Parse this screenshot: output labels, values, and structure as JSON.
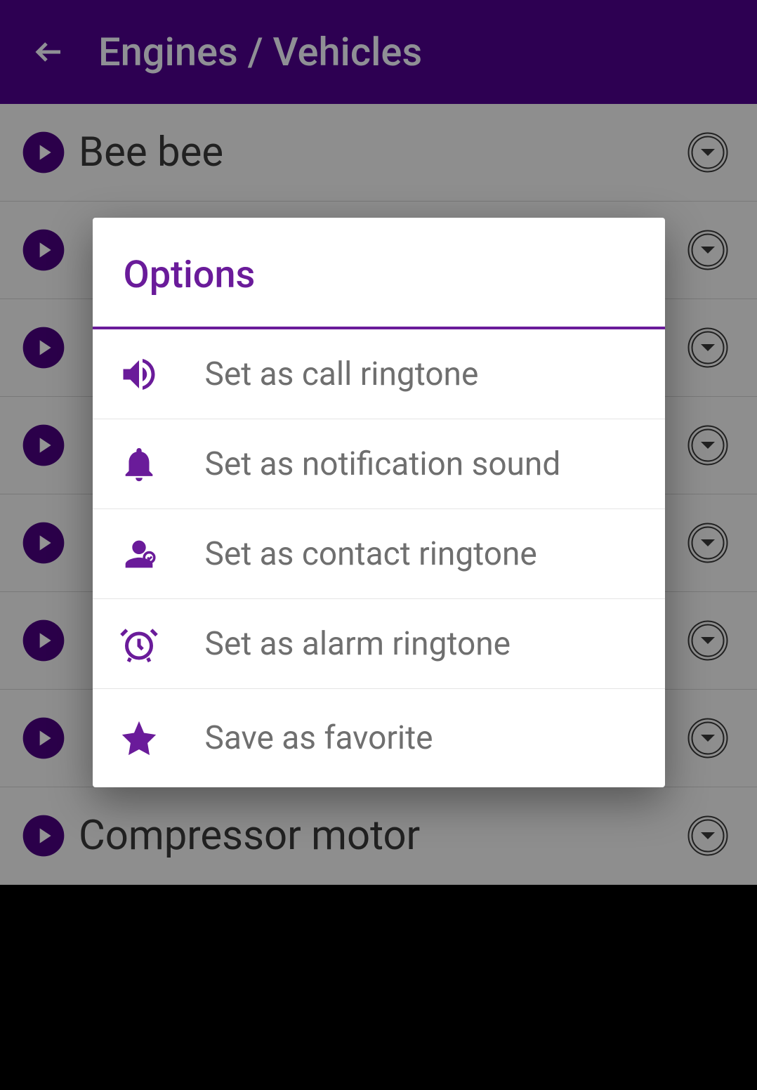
{
  "header": {
    "title": "Engines / Vehicles"
  },
  "list": {
    "items": [
      {
        "label": "Bee bee"
      },
      {
        "label": ""
      },
      {
        "label": ""
      },
      {
        "label": ""
      },
      {
        "label": ""
      },
      {
        "label": ""
      },
      {
        "label": ""
      },
      {
        "label": "Compressor motor"
      }
    ]
  },
  "dialog": {
    "title": "Options",
    "options": [
      {
        "icon": "volume-icon",
        "label": "Set as call ringtone"
      },
      {
        "icon": "bell-icon",
        "label": "Set as notification sound"
      },
      {
        "icon": "person-icon",
        "label": "Set as contact ringtone"
      },
      {
        "icon": "alarm-icon",
        "label": "Set as alarm ringtone"
      },
      {
        "icon": "star-icon",
        "label": "Save as favorite"
      }
    ]
  },
  "colors": {
    "accent": "#6a1b9a",
    "headerBg": "#2d0052"
  }
}
